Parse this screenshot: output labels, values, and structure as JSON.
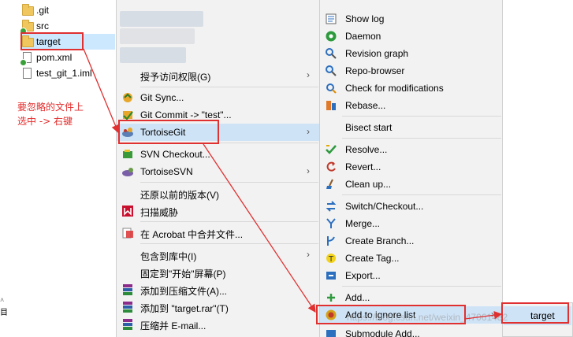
{
  "explorer": {
    "items": [
      {
        "name": ".git",
        "type": "folder",
        "badge": false
      },
      {
        "name": "src",
        "type": "folder",
        "badge": true
      },
      {
        "name": "target",
        "type": "folder",
        "badge": false,
        "selected": true
      },
      {
        "name": "pom.xml",
        "type": "file",
        "badge": true
      },
      {
        "name": "test_git_1.iml",
        "type": "file",
        "badge": false
      }
    ],
    "left_scroll_label": "目"
  },
  "annotation": {
    "line1": "要忽略的文件上",
    "line2": "选中  ->  右键"
  },
  "menu1": {
    "items": [
      {
        "label": "授予访问权限(G)",
        "icon": "none"
      },
      {
        "label": "Git Sync...",
        "icon": "git-sync-icon"
      },
      {
        "label": "Git Commit -> \"test\"...",
        "icon": "git-commit-icon"
      },
      {
        "label": "TortoiseGit",
        "icon": "tortoisegit-icon"
      },
      {
        "label": "SVN Checkout...",
        "icon": "svn-checkout-icon"
      },
      {
        "label": "TortoiseSVN",
        "icon": "tortoisesvn-icon"
      },
      {
        "label": "还原以前的版本(V)",
        "icon": "none"
      },
      {
        "label": "扫描威胁",
        "icon": "mcafee-icon"
      },
      {
        "label": "在 Acrobat 中合并文件...",
        "icon": "acrobat-icon"
      },
      {
        "label": "包含到库中(I)",
        "icon": "none"
      },
      {
        "label": "固定到\"开始\"屏幕(P)",
        "icon": "none"
      },
      {
        "label": "添加到压缩文件(A)...",
        "icon": "winrar-icon"
      },
      {
        "label": "添加到 \"target.rar\"(T)",
        "icon": "winrar-icon"
      },
      {
        "label": "压缩并 E-mail...",
        "icon": "winrar-icon"
      }
    ]
  },
  "menu2": {
    "items": [
      {
        "label": "Show log",
        "icon": "show-log-icon"
      },
      {
        "label": "Daemon",
        "icon": "daemon-icon"
      },
      {
        "label": "Revision graph",
        "icon": "revision-graph-icon"
      },
      {
        "label": "Repo-browser",
        "icon": "repo-browser-icon"
      },
      {
        "label": "Check for modifications",
        "icon": "check-modifications-icon"
      },
      {
        "label": "Rebase...",
        "icon": "rebase-icon"
      },
      {
        "label": "Bisect start",
        "icon": "none"
      },
      {
        "label": "Resolve...",
        "icon": "resolve-icon"
      },
      {
        "label": "Revert...",
        "icon": "revert-icon"
      },
      {
        "label": "Clean up...",
        "icon": "clean-up-icon"
      },
      {
        "label": "Switch/Checkout...",
        "icon": "switch-checkout-icon"
      },
      {
        "label": "Merge...",
        "icon": "merge-icon"
      },
      {
        "label": "Create Branch...",
        "icon": "create-branch-icon"
      },
      {
        "label": "Create Tag...",
        "icon": "create-tag-icon"
      },
      {
        "label": "Export...",
        "icon": "export-icon"
      },
      {
        "label": "Add...",
        "icon": "add-icon"
      },
      {
        "label": "Add to ignore list",
        "icon": "ignore-icon"
      },
      {
        "label": "Submodule Add...",
        "icon": "submodule-icon"
      }
    ]
  },
  "menu3": {
    "items": [
      {
        "label": "target"
      }
    ]
  },
  "watermark": "https://blog.csdn.net/weixin_47061482",
  "colors": {
    "highlight": "#cfe3f6",
    "annotation": "#e03030",
    "menu_bg": "#f2f2f2"
  }
}
